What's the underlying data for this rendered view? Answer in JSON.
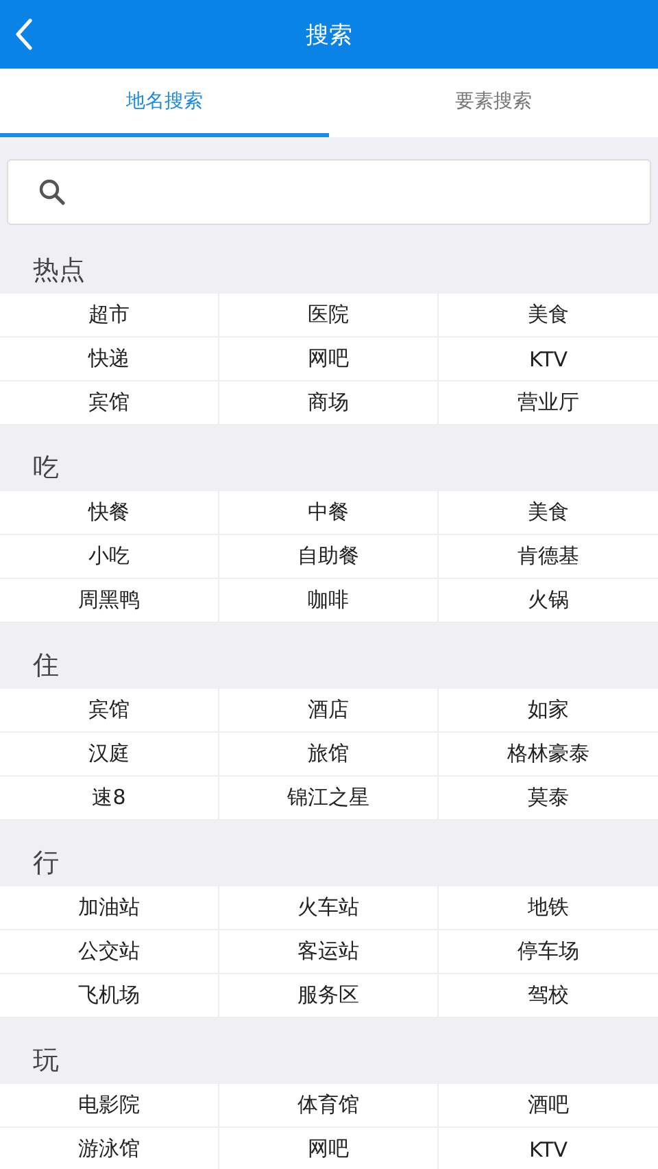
{
  "header": {
    "title": "搜索"
  },
  "tabs": [
    {
      "label": "地名搜索",
      "selected": true
    },
    {
      "label": "要素搜索",
      "selected": false
    }
  ],
  "sections": [
    {
      "title": "热点",
      "items": [
        "超市",
        "医院",
        "美食",
        "快递",
        "网吧",
        "KTV",
        "宾馆",
        "商场",
        "营业厅"
      ]
    },
    {
      "title": "吃",
      "items": [
        "快餐",
        "中餐",
        "美食",
        "小吃",
        "自助餐",
        "肯德基",
        "周黑鸭",
        "咖啡",
        "火锅"
      ]
    },
    {
      "title": "住",
      "items": [
        "宾馆",
        "酒店",
        "如家",
        "汉庭",
        "旅馆",
        "格林豪泰",
        "速8",
        "锦江之星",
        "莫泰"
      ]
    },
    {
      "title": "行",
      "items": [
        "加油站",
        "火车站",
        "地铁",
        "公交站",
        "客运站",
        "停车场",
        "飞机场",
        "服务区",
        "驾校"
      ]
    },
    {
      "title": "玩",
      "items": [
        "电影院",
        "体育馆",
        "酒吧",
        "游泳馆",
        "网吧",
        "KTV"
      ]
    }
  ]
}
